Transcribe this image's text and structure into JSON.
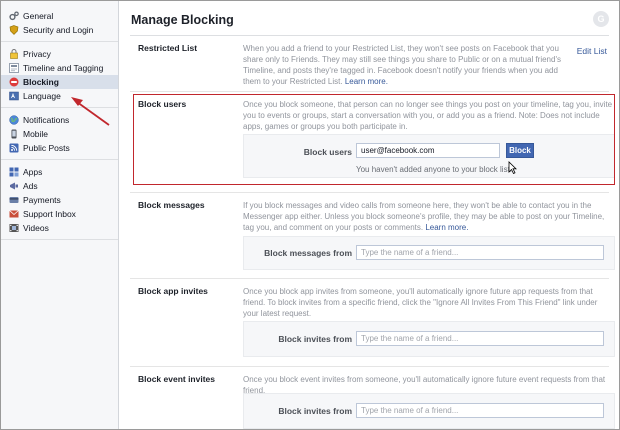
{
  "sidebar": {
    "groups": [
      [
        {
          "label": "General",
          "icon": "gears-icon",
          "active": false
        },
        {
          "label": "Security and Login",
          "icon": "shield-icon",
          "active": false
        }
      ],
      [
        {
          "label": "Privacy",
          "icon": "lock-icon",
          "active": false
        },
        {
          "label": "Timeline and Tagging",
          "icon": "timeline-icon",
          "active": false
        },
        {
          "label": "Blocking",
          "icon": "block-icon",
          "active": true
        },
        {
          "label": "Language",
          "icon": "language-icon",
          "active": false
        }
      ],
      [
        {
          "label": "Notifications",
          "icon": "globe-icon",
          "active": false
        },
        {
          "label": "Mobile",
          "icon": "mobile-icon",
          "active": false
        },
        {
          "label": "Public Posts",
          "icon": "rss-icon",
          "active": false
        }
      ],
      [
        {
          "label": "Apps",
          "icon": "apps-icon",
          "active": false
        },
        {
          "label": "Ads",
          "icon": "ads-icon",
          "active": false
        },
        {
          "label": "Payments",
          "icon": "payments-icon",
          "active": false
        },
        {
          "label": "Support Inbox",
          "icon": "support-icon",
          "active": false
        },
        {
          "label": "Videos",
          "icon": "videos-icon",
          "active": false
        }
      ]
    ]
  },
  "main": {
    "title": "Manage Blocking",
    "restricted": {
      "label": "Restricted List",
      "desc": "When you add a friend to your Restricted List, they won't see posts on Facebook that you share only to Friends. They may still see things you share to Public or on a mutual friend's Timeline, and posts they're tagged in. Facebook doesn't notify your friends when you add them to your Restricted List.",
      "learn_more": "Learn more.",
      "edit": "Edit List"
    },
    "block_users": {
      "label": "Block users",
      "desc": "Once you block someone, that person can no longer see things you post on your timeline, tag you, invite you to events or groups, start a conversation with you, or add you as a friend. Note: Does not include apps, games or groups you both participate in.",
      "field_label": "Block users",
      "value": "user@facebook.com",
      "button": "Block",
      "hint": "You haven't added anyone to your block list."
    },
    "block_messages": {
      "label": "Block messages",
      "desc": "If you block messages and video calls from someone here, they won't be able to contact you in the Messenger app either. Unless you block someone's profile, they may be able to post on your Timeline, tag you, and comment on your posts or comments.",
      "learn_more": "Learn more.",
      "field_label": "Block messages from",
      "placeholder": "Type the name of a friend..."
    },
    "block_app_invites": {
      "label": "Block app invites",
      "desc": "Once you block app invites from someone, you'll automatically ignore future app requests from that friend. To block invites from a specific friend, click the \"Ignore All Invites From This Friend\" link under your latest request.",
      "field_label": "Block invites from",
      "placeholder": "Type the name of a friend..."
    },
    "block_event_invites": {
      "label": "Block event invites",
      "desc": "Once you block event invites from someone, you'll automatically ignore future event requests from that friend.",
      "field_label": "Block invites from",
      "placeholder": "Type the name of a friend..."
    }
  },
  "colors": {
    "accent": "#4267b2",
    "link": "#365899",
    "highlight": "#c1272d",
    "active_nav": "#d8dfea"
  }
}
